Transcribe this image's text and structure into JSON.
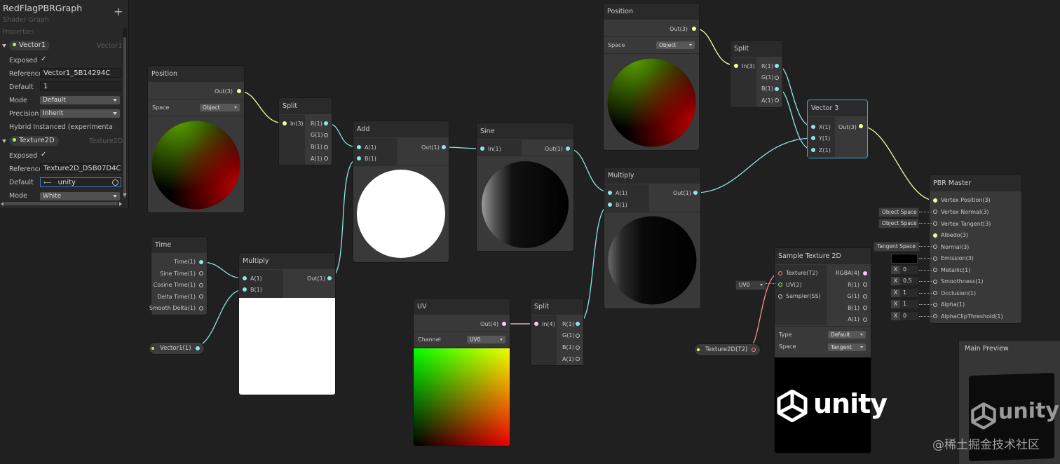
{
  "blackboard": {
    "title": "RedFlagPBRGraph",
    "subtitle": "Shader Graph",
    "add_glyph": "+",
    "section": "Properties",
    "vector1": {
      "name": "Vector1",
      "type": "Vector1",
      "dot_color": "#8fe7e7",
      "exposed_label": "Exposed",
      "exposed_check": "✓",
      "reference_label": "Reference",
      "reference": "Vector1_5B14294C",
      "default_label": "Default",
      "default": "1",
      "mode_label": "Mode",
      "mode": "Default",
      "precision_label": "Precision",
      "precision": "Inherit",
      "hybrid_label": "Hybrid Instanced (experimental)"
    },
    "texture2d": {
      "name": "Texture2D",
      "type": "Texture2D",
      "dot_color": "#ff8b8b",
      "exposed_label": "Exposed",
      "exposed_check": "✓",
      "reference_label": "Reference",
      "reference": "Texture2D_D5B07D4C",
      "default_label": "Default",
      "default_icon": "⟵",
      "default": "unity",
      "mode_label": "Mode",
      "mode": "White"
    }
  },
  "nodes": {
    "position1": {
      "title": "Position",
      "out": "Out(3)",
      "space_label": "Space",
      "space": "Object"
    },
    "position2": {
      "title": "Position",
      "out": "Out(3)",
      "space_label": "Space",
      "space": "Object"
    },
    "split1": {
      "title": "Split",
      "in": "In(3)",
      "outs": [
        "R(1)",
        "G(1)",
        "B(1)",
        "A(1)"
      ]
    },
    "split2": {
      "title": "Split",
      "in": "In(3)",
      "outs": [
        "R(1)",
        "G(1)",
        "B(1)",
        "A(1)"
      ]
    },
    "split3": {
      "title": "Split",
      "in": "In(4)",
      "outs": [
        "R(1)",
        "G(1)",
        "B(1)",
        "A(1)"
      ]
    },
    "add": {
      "title": "Add",
      "ins": [
        "A(1)",
        "B(1)"
      ],
      "out": "Out(1)"
    },
    "sine": {
      "title": "Sine",
      "in": "In(1)",
      "out": "Out(1)"
    },
    "multiply1": {
      "title": "Multiply",
      "ins": [
        "A(1)",
        "B(1)"
      ],
      "out": "Out(1)"
    },
    "multiply2": {
      "title": "Multiply",
      "ins": [
        "A(1)",
        "B(1)"
      ],
      "out": "Out(1)"
    },
    "time": {
      "title": "Time",
      "outs": [
        "Time(1)",
        "Sine Time(1)",
        "Cosine Time(1)",
        "Delta Time(1)",
        "Smooth Delta(1)"
      ]
    },
    "uv": {
      "title": "UV",
      "out": "Out(4)",
      "channel_label": "Channel",
      "channel": "UV0"
    },
    "vector3": {
      "title": "Vector 3",
      "ins": [
        "X(1)",
        "Y(1)",
        "Z(1)"
      ],
      "out": "Out(3)"
    },
    "sample": {
      "title": "Sample Texture 2D",
      "ins": [
        "Texture(T2)",
        "UV(2)",
        "Sampler(SS)"
      ],
      "outs": [
        "RGBA(4)",
        "R(1)",
        "G(1)",
        "B(1)",
        "A(1)"
      ],
      "type_label": "Type",
      "type": "Default",
      "space_label": "Space",
      "space": "Tangent",
      "uv_tag": "UV0",
      "preview_text": "unity"
    },
    "master": {
      "title": "PBR Master",
      "ins": [
        "Vertex Position(3)",
        "Vertex Normal(3)",
        "Vertex Tangent(3)",
        "Albedo(3)",
        "Normal(3)",
        "Emission(3)",
        "Metallic(1)",
        "Smoothness(1)",
        "Occlusion(1)",
        "Alpha(1)",
        "AlphaClipThreshold(1)"
      ],
      "tags": {
        "vn": "Object Space",
        "vt": "Object Space",
        "normal": "Tangent Space"
      },
      "x_label": "X",
      "values": {
        "metallic": "0",
        "smoothness": "0.5",
        "occlusion": "1",
        "alpha": "1",
        "clip": "0"
      }
    },
    "prop_vector1": {
      "label": "Vector1(1)"
    },
    "prop_texture": {
      "label": "Texture2D(T2)"
    }
  },
  "main_preview": {
    "title": "Main Preview",
    "preview_text": "unity"
  },
  "watermark": "@稀土掘金技术社区",
  "colors": {
    "float": "#8fe7e7",
    "vector3": "#f6ff9a",
    "vector4": "#fbcbf4",
    "texture": "#ff8b8b",
    "selection": "#44a8dc"
  }
}
